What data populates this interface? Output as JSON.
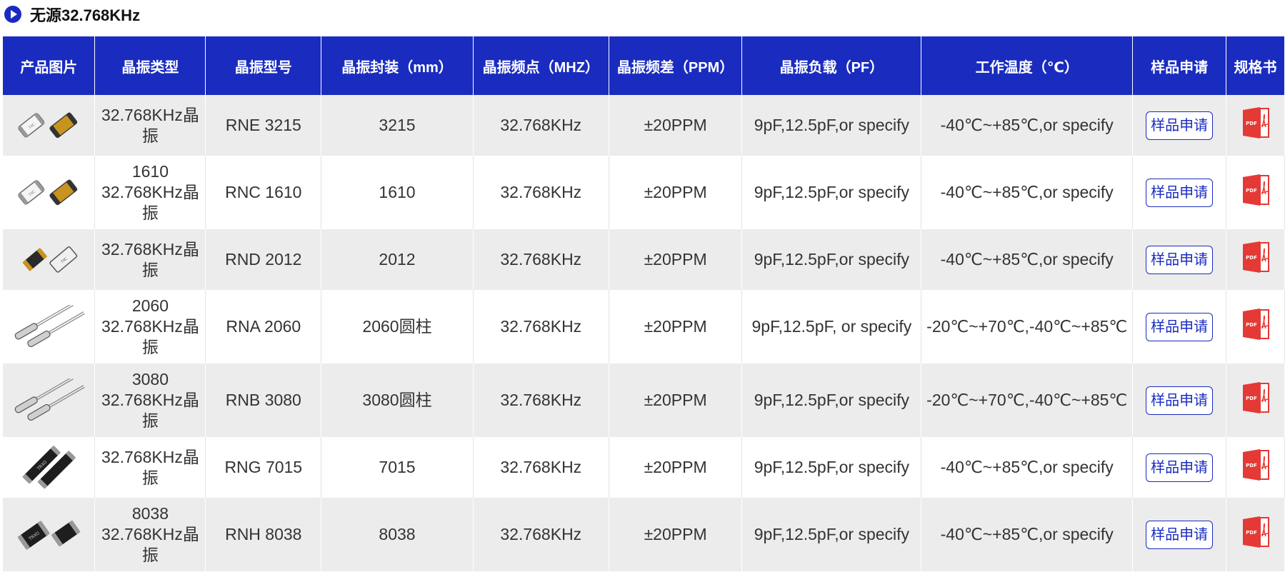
{
  "heading": {
    "title": "无源32.768KHz"
  },
  "table": {
    "headers": [
      "产品图片",
      "晶振类型",
      "晶振型号",
      "晶振封装（mm）",
      "晶振频点（MHZ）",
      "晶振频差（PPM）",
      "晶振负载（PF）",
      "工作温度（℃）",
      "样品申请",
      "规格书"
    ],
    "rows": [
      {
        "type_lines": [
          "32.768KHz晶",
          "振"
        ],
        "model": "RNE 3215",
        "package": "3215",
        "freq": "32.768KHz",
        "ppm": "±20PPM",
        "load": "9pF,12.5pF,or specify",
        "temp": "-40℃~+85℃,or specify",
        "sample": "样品申请",
        "image": "smd-silver-gold"
      },
      {
        "type_lines": [
          "1610",
          "32.768KHz晶",
          "振"
        ],
        "model": "RNC 1610",
        "package": "1610",
        "freq": "32.768KHz",
        "ppm": "±20PPM",
        "load": "9pF,12.5pF,or specify",
        "temp": "-40℃~+85℃,or specify",
        "sample": "样品申请",
        "image": "smd-silver-gold"
      },
      {
        "type_lines": [
          "32.768KHz晶",
          "振"
        ],
        "model": "RND 2012",
        "package": "2012",
        "freq": "32.768KHz",
        "ppm": "±20PPM",
        "load": "9pF,12.5pF,or specify",
        "temp": "-40℃~+85℃,or specify",
        "sample": "样品申请",
        "image": "smd-black-silver"
      },
      {
        "type_lines": [
          "2060",
          "32.768KHz晶",
          "振"
        ],
        "model": "RNA 2060",
        "package": "2060圆柱",
        "freq": "32.768KHz",
        "ppm": "±20PPM",
        "load": "9pF,12.5pF, or specify",
        "temp": "-20℃~+70℃,-40℃~+85℃",
        "sample": "样品申请",
        "image": "cylinder-leads"
      },
      {
        "type_lines": [
          "3080",
          "32.768KHz晶",
          "振"
        ],
        "model": "RNB 3080",
        "package": "3080圆柱",
        "freq": "32.768KHz",
        "ppm": "±20PPM",
        "load": "9pF,12.5pF,or specify",
        "temp": "-20℃~+70℃,-40℃~+85℃",
        "sample": "样品申请",
        "image": "cylinder-leads"
      },
      {
        "type_lines": [
          "32.768KHz晶",
          "振"
        ],
        "model": "RNG 7015",
        "package": "7015",
        "freq": "32.768KHz",
        "ppm": "±20PPM",
        "load": "9pF,12.5pF,or specify",
        "temp": "-40℃~+85℃,or specify",
        "sample": "样品申请",
        "image": "smd-black-long"
      },
      {
        "type_lines": [
          "8038",
          "32.768KHz晶",
          "振"
        ],
        "model": "RNH 8038",
        "package": "8038",
        "freq": "32.768KHz",
        "ppm": "±20PPM",
        "load": "9pF,12.5pF,or specify",
        "temp": "-40℃~+85℃,or specify",
        "sample": "样品申请",
        "image": "smd-black-short"
      }
    ]
  },
  "colors": {
    "header_bg": "#1a2cbf",
    "stripe": "#ececec",
    "accent": "#1a2cbf",
    "pdf": "#e53935"
  }
}
